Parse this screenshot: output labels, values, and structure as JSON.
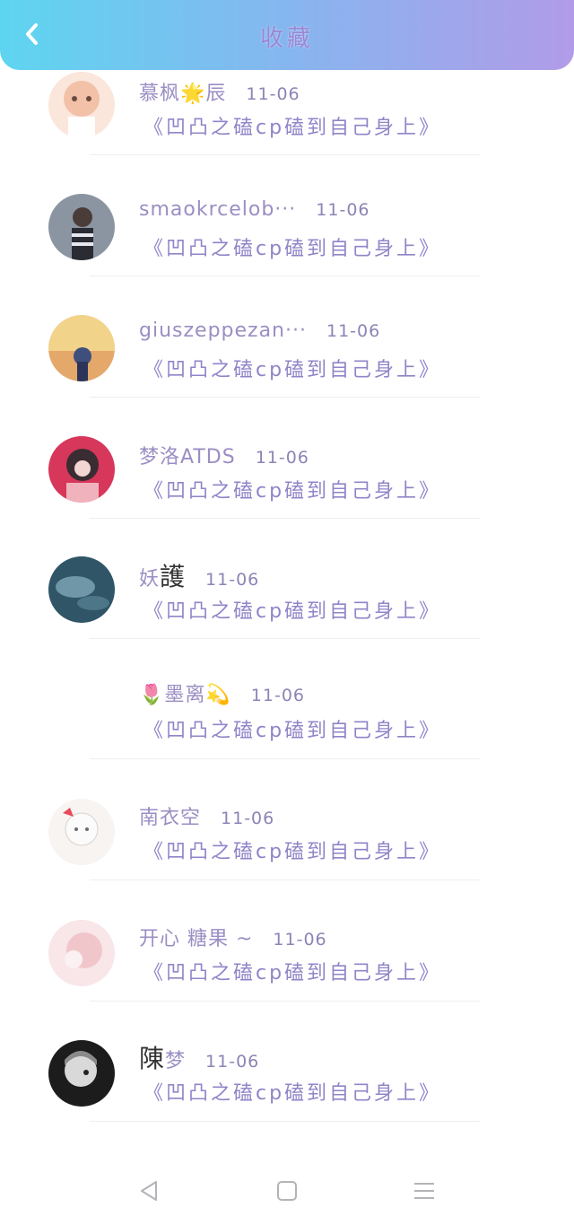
{
  "header": {
    "title": "收藏",
    "back_icon": "chevron-left-icon"
  },
  "comment_text": "《凹凸之磕cp磕到自己身上》",
  "items": [
    {
      "name": "慕枫🌟辰",
      "time": "11-06",
      "content": "《凹凸之磕cp磕到自己身上》",
      "avatar_color": "#f3c7b2"
    },
    {
      "name": "smaokrcelob···",
      "time": "11-06",
      "content": "《凹凸之磕cp磕到自己身上》",
      "avatar_color": "#7f8a97"
    },
    {
      "name": "giuszeppezan···",
      "time": "11-06",
      "content": "《凹凸之磕cp磕到自己身上》",
      "avatar_color": "#e6b86a"
    },
    {
      "name": "梦洛ATDS",
      "time": "11-06",
      "content": "《凹凸之磕cp磕到自己身上》",
      "avatar_color": "#d23a57"
    },
    {
      "name": "妖",
      "name_big": "護",
      "time": "11-06",
      "content": "《凹凸之磕cp磕到自己身上》",
      "avatar_color": "#2f5567"
    },
    {
      "name": "🌷墨离💫",
      "time": "11-06",
      "content": "《凹凸之磕cp磕到自己身上》",
      "avatar_color": "#ffffff"
    },
    {
      "name": "南衣空",
      "time": "11-06",
      "content": "《凹凸之磕cp磕到自己身上》",
      "avatar_color": "#f4f1ef"
    },
    {
      "name": "开心 糖果 ~",
      "time": "11-06",
      "content": "《凹凸之磕cp磕到自己身上》",
      "avatar_color": "#f5d9dc"
    },
    {
      "name": "梦",
      "name_big": "陳",
      "time": "11-06",
      "content": "《凹凸之磕cp磕到自己身上》",
      "avatar_color": "#222222"
    }
  ],
  "navbar": {
    "back_icon": "triangle-back-icon",
    "home_icon": "square-home-icon",
    "menu_icon": "menu-lines-icon"
  }
}
